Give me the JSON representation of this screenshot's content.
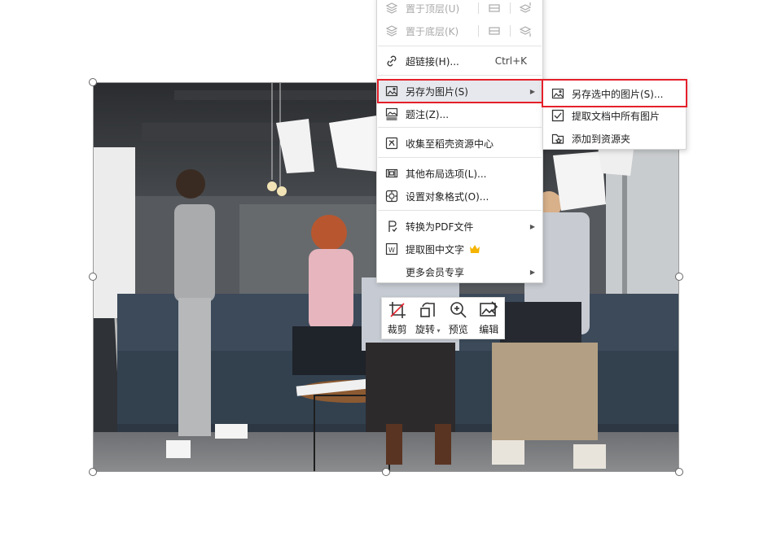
{
  "context_menu": {
    "items": [
      {
        "label": "置于顶层(U)",
        "icon": "bring-to-front-icon",
        "disabled": true
      },
      {
        "label": "置于底层(K)",
        "icon": "send-to-back-icon",
        "disabled": true
      },
      {
        "label": "超链接(H)...",
        "icon": "hyperlink-icon",
        "shortcut": "Ctrl+K"
      },
      {
        "label": "另存为图片(S)",
        "icon": "save-as-image-icon",
        "has_submenu": true,
        "highlighted": true
      },
      {
        "label": "题注(Z)...",
        "icon": "caption-icon"
      },
      {
        "label": "收集至稻壳资源中心",
        "icon": "collect-icon"
      },
      {
        "label": "其他布局选项(L)...",
        "icon": "layout-options-icon"
      },
      {
        "label": "设置对象格式(O)...",
        "icon": "format-object-icon"
      },
      {
        "label": "转换为PDF文件",
        "icon": "convert-pdf-icon",
        "has_submenu": true
      },
      {
        "label": "提取图中文字",
        "icon": "extract-text-icon",
        "badge_icon": "crown-icon"
      },
      {
        "label": "更多会员专享",
        "has_submenu": true
      }
    ]
  },
  "submenu": {
    "items": [
      {
        "label": "另存选中的图片(S)...",
        "icon": "save-selected-image-icon",
        "highlighted": true
      },
      {
        "label": "提取文档中所有图片",
        "icon": "extract-all-images-icon"
      },
      {
        "label": "添加到资源夹",
        "icon": "add-to-resources-icon"
      }
    ]
  },
  "picture_toolbar": {
    "buttons": [
      {
        "label": "裁剪",
        "icon": "crop-icon"
      },
      {
        "label": "旋转",
        "icon": "rotate-icon",
        "dropdown": true
      },
      {
        "label": "预览",
        "icon": "zoom-preview-icon"
      },
      {
        "label": "编辑",
        "icon": "edit-image-icon"
      }
    ]
  },
  "colors": {
    "highlight_border": "#e5202a",
    "menu_hover": "#e6e8ed",
    "crown": "#f5b400"
  }
}
